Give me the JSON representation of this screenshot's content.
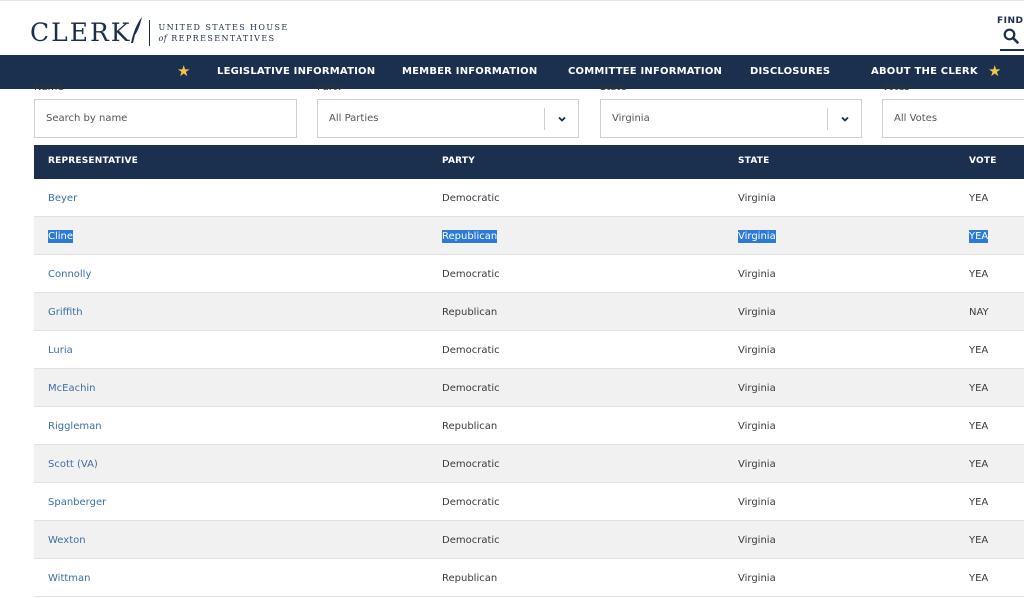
{
  "header": {
    "logo_word": "CLERK",
    "logo_line1": "UNITED STATES HOUSE",
    "logo_of": "of",
    "logo_line2": "REPRESENTATIVES",
    "find_label": "FIND"
  },
  "nav": {
    "items": [
      "LEGISLATIVE INFORMATION",
      "MEMBER INFORMATION",
      "COMMITTEE INFORMATION",
      "DISCLOSURES",
      "ABOUT THE CLERK"
    ],
    "star_color": "#f3c744",
    "bg_color": "#1b2f4f"
  },
  "filters": {
    "name": {
      "label": "Name",
      "placeholder": "Search by name"
    },
    "party": {
      "label": "Party",
      "value": "All Parties"
    },
    "state": {
      "label": "State",
      "value": "Virginia"
    },
    "votes": {
      "label": "Votes",
      "value": "All Votes"
    }
  },
  "table": {
    "columns": [
      "REPRESENTATIVE",
      "PARTY",
      "STATE",
      "VOTE"
    ],
    "rows": [
      {
        "name": "Beyer",
        "party": "Democratic",
        "state": "Virginia",
        "vote": "YEA"
      },
      {
        "name": "Cline",
        "party": "Republican",
        "state": "Virginia",
        "vote": "YEA"
      },
      {
        "name": "Connolly",
        "party": "Democratic",
        "state": "Virginia",
        "vote": "YEA"
      },
      {
        "name": "Griffith",
        "party": "Republican",
        "state": "Virginia",
        "vote": "NAY"
      },
      {
        "name": "Luria",
        "party": "Democratic",
        "state": "Virginia",
        "vote": "YEA"
      },
      {
        "name": "McEachin",
        "party": "Democratic",
        "state": "Virginia",
        "vote": "YEA"
      },
      {
        "name": "Riggleman",
        "party": "Republican",
        "state": "Virginia",
        "vote": "YEA"
      },
      {
        "name": "Scott (VA)",
        "party": "Democratic",
        "state": "Virginia",
        "vote": "YEA"
      },
      {
        "name": "Spanberger",
        "party": "Democratic",
        "state": "Virginia",
        "vote": "YEA"
      },
      {
        "name": "Wexton",
        "party": "Democratic",
        "state": "Virginia",
        "vote": "YEA"
      },
      {
        "name": "Wittman",
        "party": "Republican",
        "state": "Virginia",
        "vote": "YEA"
      }
    ]
  },
  "colors": {
    "link": "#3a6fa8",
    "selection": "#2b7ad6",
    "alt_row": "#f1f1f1"
  }
}
